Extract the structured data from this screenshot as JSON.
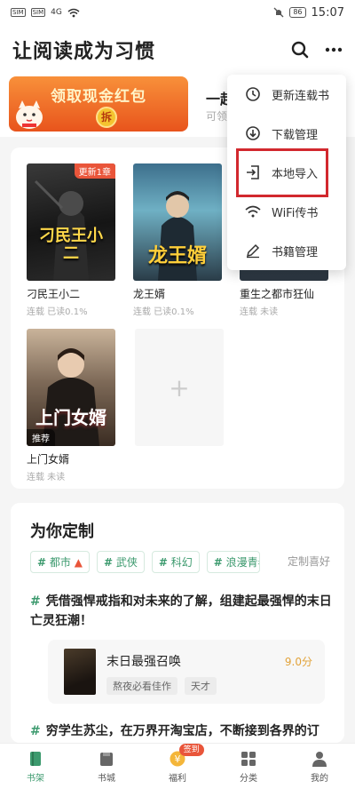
{
  "status_bar": {
    "sim1": "SIM",
    "sim2": "SIM",
    "signal": "4G",
    "battery": "86",
    "time": "15:07"
  },
  "header": {
    "title": "让阅读成为习惯",
    "search_icon": "search-icon",
    "more_icon": "more-icon"
  },
  "banner": {
    "redpack_label": "领取现金红包",
    "redpack_button": "拆",
    "right_title": "一起",
    "right_sub": "可领"
  },
  "shelf": {
    "books": [
      {
        "title": "刁民王小二",
        "meta": "连载  已读0.1%",
        "badge": "更新1章",
        "cover_text": "刁民王小二"
      },
      {
        "title": "龙王婿",
        "meta": "连载  已读0.1%",
        "cover_text": "龙王婿"
      },
      {
        "title": "重生之都市狂仙",
        "meta": "连载  未读"
      },
      {
        "title": "上门女婿",
        "meta": "连载  未读",
        "badge": "推荐",
        "cover_text": "上门女婿"
      }
    ],
    "add_label": "+"
  },
  "custom": {
    "title": "为你定制",
    "tags": [
      "都市",
      "武侠",
      "科幻",
      "浪漫青春"
    ],
    "preference": "定制喜好",
    "rec1_text": "凭借强悍戒指和对未来的了解，组建起最强悍的末日亡灵狂潮！",
    "rec1_book": {
      "title": "末日最强召唤",
      "score": "9.0分",
      "tags": [
        "熬夜必看佳作",
        "天才"
      ]
    },
    "rec2_text": "穷学生苏尘，在万界开淘宝店，不断接到各界的订"
  },
  "dropdown": {
    "items": [
      {
        "label": "更新连载书",
        "icon": "clock-icon"
      },
      {
        "label": "下载管理",
        "icon": "download-icon"
      },
      {
        "label": "本地导入",
        "icon": "import-icon"
      },
      {
        "label": "WiFi传书",
        "icon": "wifi-icon"
      },
      {
        "label": "书籍管理",
        "icon": "pencil-icon"
      }
    ]
  },
  "bottom_nav": {
    "items": [
      {
        "label": "书架",
        "icon": "bookshelf-icon"
      },
      {
        "label": "书城",
        "icon": "bookstore-icon"
      },
      {
        "label": "福利",
        "icon": "welfare-icon",
        "badge": "签到"
      },
      {
        "label": "分类",
        "icon": "category-icon"
      },
      {
        "label": "我的",
        "icon": "profile-icon"
      }
    ]
  },
  "colors": {
    "accent": "#3c9a6e",
    "highlight": "#d2282e",
    "badge": "#e9553a"
  }
}
